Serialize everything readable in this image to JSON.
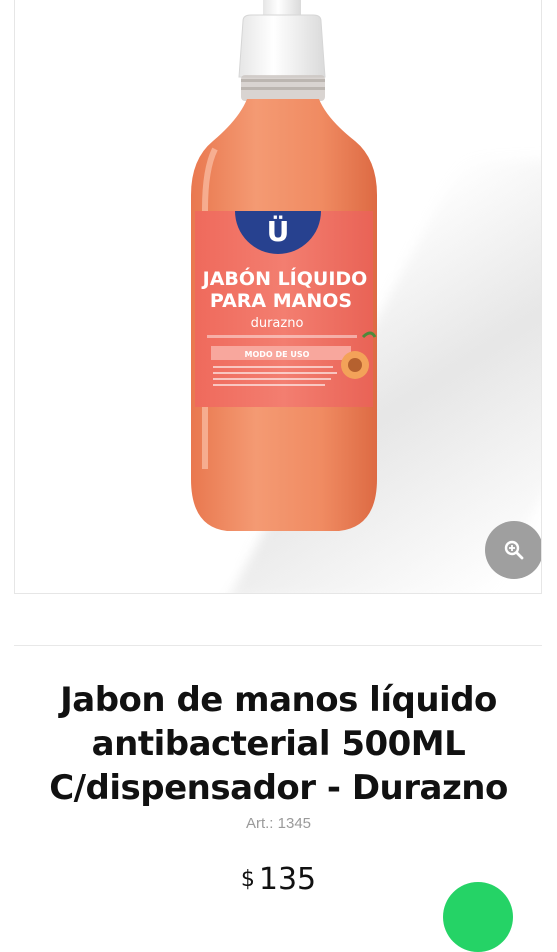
{
  "product_image": {
    "label_brand": "Ü",
    "label_line1": "JABÓN LÍQUIDO",
    "label_line2": "PARA MANOS",
    "label_variant": "durazno",
    "label_mode": "MODO DE USO",
    "zoom_icon": "zoom-in-icon"
  },
  "product": {
    "title": "Jabon de manos líquido antibacterial 500ML C/dispensador - Durazno",
    "sku": "Art.: 1345",
    "currency": "$",
    "price": "135"
  },
  "floating": {
    "whatsapp_icon": "whatsapp-icon",
    "color": "#25d366"
  },
  "colors": {
    "zoom_button": "#9f9f9f",
    "title": "#111111",
    "sku": "#9a9a9a"
  }
}
